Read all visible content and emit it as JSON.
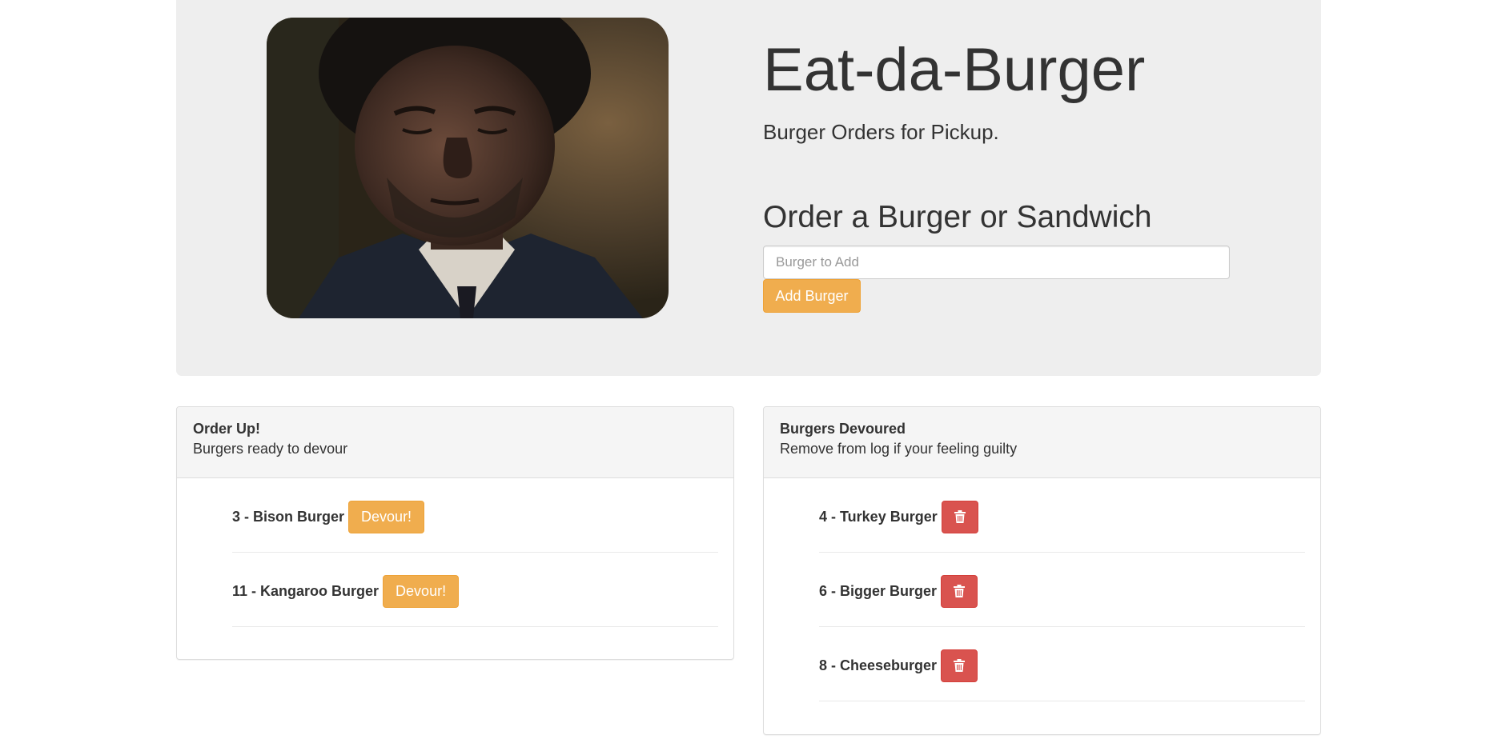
{
  "header": {
    "title": "Eat-da-Burger",
    "subtitle": "Burger Orders for Pickup.",
    "hero_image": "man-in-suit-portrait-photo"
  },
  "order_form": {
    "heading": "Order a Burger or Sandwich",
    "input_placeholder": "Burger to Add",
    "input_value": "",
    "add_button_label": "Add Burger"
  },
  "order_up": {
    "title": "Order Up!",
    "subtitle": "Burgers ready to devour",
    "items": [
      {
        "label": "3 - Bison Burger",
        "button_label": "Devour!"
      },
      {
        "label": "11 - Kangaroo Burger",
        "button_label": "Devour!"
      }
    ]
  },
  "devoured": {
    "title": "Burgers Devoured",
    "subtitle": "Remove from log if your feeling guilty",
    "items": [
      {
        "label": "4 - Turkey Burger",
        "button_icon": "trash-icon"
      },
      {
        "label": "6 - Bigger Burger",
        "button_icon": "trash-icon"
      },
      {
        "label": "8 - Cheeseburger",
        "button_icon": "trash-icon"
      }
    ]
  },
  "colors": {
    "jumbotron_bg": "#eeeeee",
    "warning": "#f0ad4e",
    "danger": "#d9534f",
    "panel_heading_bg": "#f5f5f5"
  }
}
